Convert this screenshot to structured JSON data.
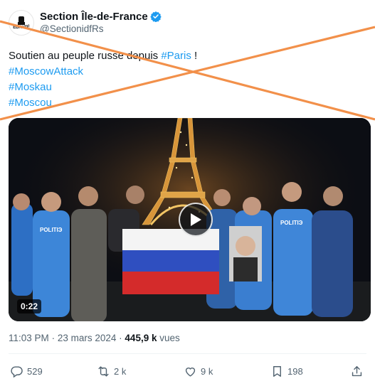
{
  "account": {
    "display_name": "Section Île-de-France",
    "handle": "@SectionidfRs",
    "avatar_text": "ÉDAUTÉ"
  },
  "tweet": {
    "text_before": "Soutien au peuple russe depuis ",
    "tag_inline": "#Paris",
    "text_after": " !",
    "hashtags": [
      "#MoscowAttack",
      "#Moskau",
      "#Moscou"
    ]
  },
  "media": {
    "duration": "0:22",
    "shirt_text": "POLITIЭ"
  },
  "meta": {
    "time": "11:03 PM",
    "date": "23 mars 2024",
    "views_count": "445,9 k",
    "views_label": "vues"
  },
  "actions": {
    "replies": "529",
    "reposts": "2 k",
    "likes": "9 k",
    "bookmarks": "198"
  },
  "colors": {
    "accent": "#1d9bf0",
    "cross": "#f2904a",
    "muted": "#536471"
  }
}
